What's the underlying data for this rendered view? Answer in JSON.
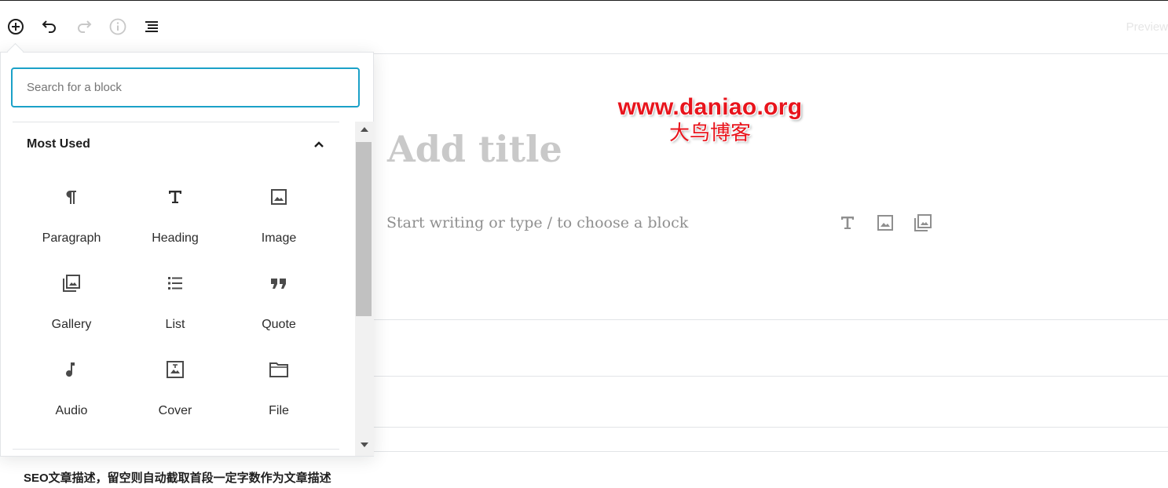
{
  "toolbar": {
    "add_icon": "plus-circle-icon",
    "undo_icon": "undo-icon",
    "redo_icon": "redo-icon",
    "info_icon": "info-icon",
    "outline_icon": "list-view-icon",
    "preview_label": "Preview"
  },
  "watermark": {
    "url": "www.daniao.org",
    "name": "大鸟博客"
  },
  "editor": {
    "title_placeholder": "Add title",
    "body_placeholder": "Start writing or type / to choose a block",
    "inline_icons": [
      "heading-icon",
      "image-icon",
      "gallery-icon"
    ]
  },
  "seo": {
    "label": "SEO文章描述，留空则自动截取首段一定字数作为文章描述"
  },
  "inserter": {
    "search_placeholder": "Search for a block",
    "panel_title": "Most Used",
    "blocks": [
      {
        "label": "Paragraph",
        "icon": "paragraph-icon"
      },
      {
        "label": "Heading",
        "icon": "heading-icon"
      },
      {
        "label": "Image",
        "icon": "image-icon"
      },
      {
        "label": "Gallery",
        "icon": "gallery-icon"
      },
      {
        "label": "List",
        "icon": "list-icon"
      },
      {
        "label": "Quote",
        "icon": "quote-icon"
      },
      {
        "label": "Audio",
        "icon": "audio-icon"
      },
      {
        "label": "Cover",
        "icon": "cover-icon"
      },
      {
        "label": "File",
        "icon": "file-icon"
      }
    ]
  },
  "colors": {
    "accent": "#1ba1c8",
    "watermark": "#e8141c",
    "placeholder_title": "#c9c9c9"
  }
}
